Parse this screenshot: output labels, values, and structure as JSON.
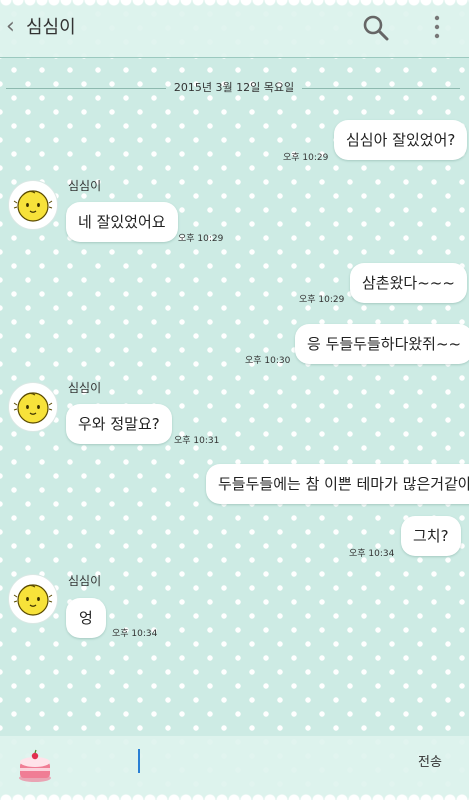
{
  "header": {
    "back_glyph": "‹",
    "title": "심심이"
  },
  "date_divider": "2015년 3월 12일 목요일",
  "messages": [
    {
      "side": "me",
      "text": "심심아 잘있었어?",
      "time": "오후 10:29"
    },
    {
      "side": "bot",
      "sender": "심심이",
      "text": "네 잘있었어요",
      "time": "오후 10:29"
    },
    {
      "side": "me",
      "text": "삼촌왔다~~~",
      "time": "오후 10:29"
    },
    {
      "side": "me",
      "text": "응 두들두들하다왔쥐~~",
      "time": "오후 10:30"
    },
    {
      "side": "bot",
      "sender": "심심이",
      "text": "우와 정말요?",
      "time": "오후 10:31"
    },
    {
      "side": "me",
      "text": "두들두들에는 참 이쁜 테마가 많은거같아",
      "time": ""
    },
    {
      "side": "me",
      "text": "그치?",
      "time": "오후 10:34"
    },
    {
      "side": "bot",
      "sender": "심심이",
      "text": "엉",
      "time": "오후 10:34"
    }
  ],
  "input": {
    "send_label": "전송",
    "value": ""
  },
  "colors": {
    "background": "#cdebe4",
    "bubble": "#ffffff",
    "caret": "#2a7fd4",
    "avatar_yellow": "#f7e23a"
  },
  "icons": {
    "search": "search-icon",
    "menu": "more-vertical-icon",
    "emoticon": "cake-emoticon-icon",
    "avatar": "simsimi-avatar-icon"
  }
}
